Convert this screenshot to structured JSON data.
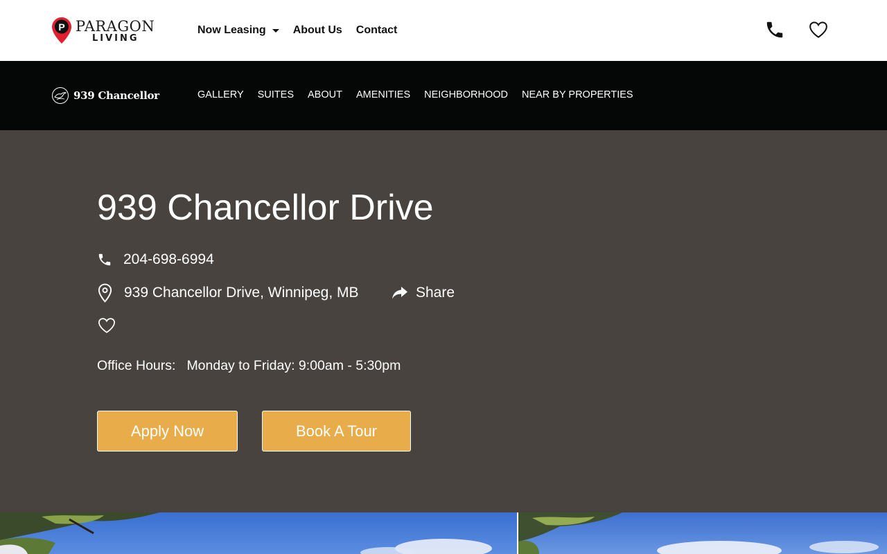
{
  "brand": {
    "name": "PARAGON",
    "subname": "LIVING",
    "pin_letter": "P",
    "accent_color": "#e0202e"
  },
  "main_nav": {
    "items": [
      {
        "label": "Now Leasing",
        "has_dropdown": true
      },
      {
        "label": "About Us"
      },
      {
        "label": "Contact"
      }
    ]
  },
  "header_icons": [
    "phone-icon",
    "heart-icon"
  ],
  "property_bar": {
    "logo_text": "939 Chancellor",
    "nav": [
      "GALLERY",
      "SUITES",
      "ABOUT",
      "AMENITIES",
      "NEIGHBORHOOD",
      "NEAR BY PROPERTIES"
    ]
  },
  "hero": {
    "title": "939 Chancellor Drive",
    "phone": "204-698-6994",
    "address": "939 Chancellor Drive, Winnipeg, MB",
    "share_label": "Share",
    "office_hours_label": "Office Hours:",
    "office_hours_value": "Monday to Friday: 9:00am - 5:30pm",
    "apply_button": "Apply Now",
    "tour_button": "Book A Tour",
    "background_color": "#48433e",
    "button_color": "#e8ad4a"
  },
  "photos": [
    "building-photo",
    "building-photo"
  ]
}
